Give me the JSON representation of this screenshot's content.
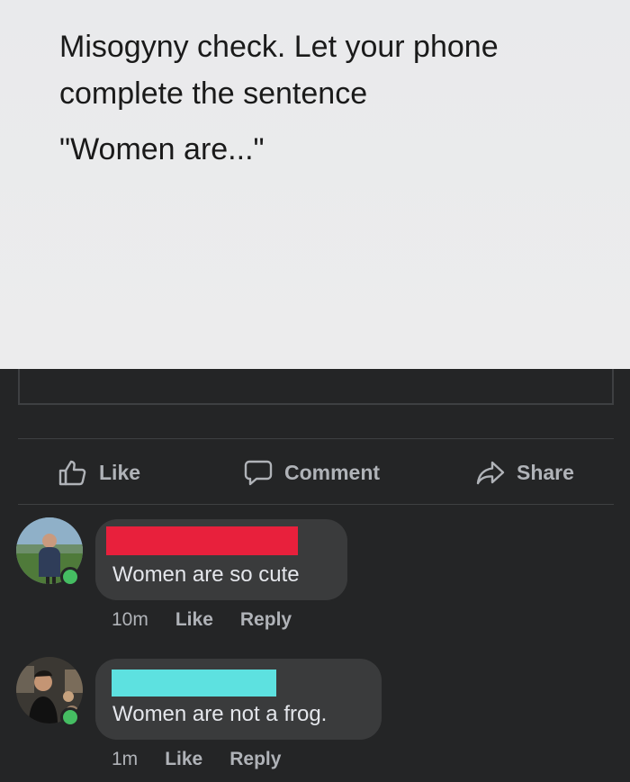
{
  "post": {
    "line1": "Misogyny check. Let your phone",
    "line2": "complete the sentence",
    "line3": "\"Women are...\""
  },
  "actions": {
    "like": "Like",
    "comment": "Comment",
    "share": "Share"
  },
  "comments": [
    {
      "redaction_color": "#e8203c",
      "text": "Women are so cute",
      "time": "10m",
      "like": "Like",
      "reply": "Reply"
    },
    {
      "redaction_color": "#5de1e0",
      "text": "Women are not a frog.",
      "time": "1m",
      "like": "Like",
      "reply": "Reply"
    }
  ],
  "colors": {
    "background": "#242526",
    "card": "#ececed",
    "bubble": "#3a3b3c",
    "online": "#45bd62"
  }
}
